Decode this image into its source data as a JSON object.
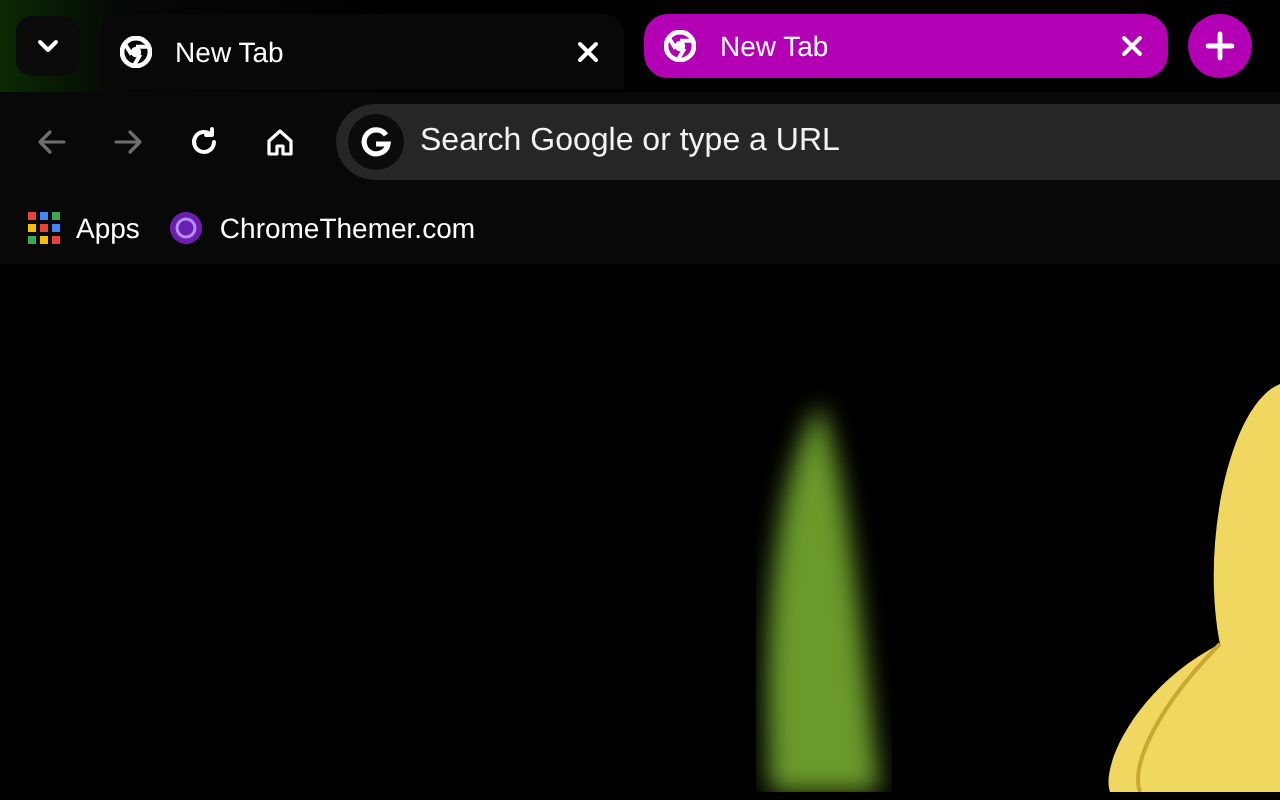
{
  "tabs": [
    {
      "title": "New Tab",
      "selected": true
    },
    {
      "title": "New Tab",
      "selected": false
    }
  ],
  "toolbar": {
    "back": {
      "disabled": true
    },
    "forward": {
      "disabled": true
    },
    "omnibox": {
      "placeholder": "Search Google or type a URL"
    }
  },
  "bookmarks": [
    {
      "kind": "apps",
      "label": "Apps"
    },
    {
      "kind": "site",
      "label": "ChromeThemer.com"
    }
  ]
}
